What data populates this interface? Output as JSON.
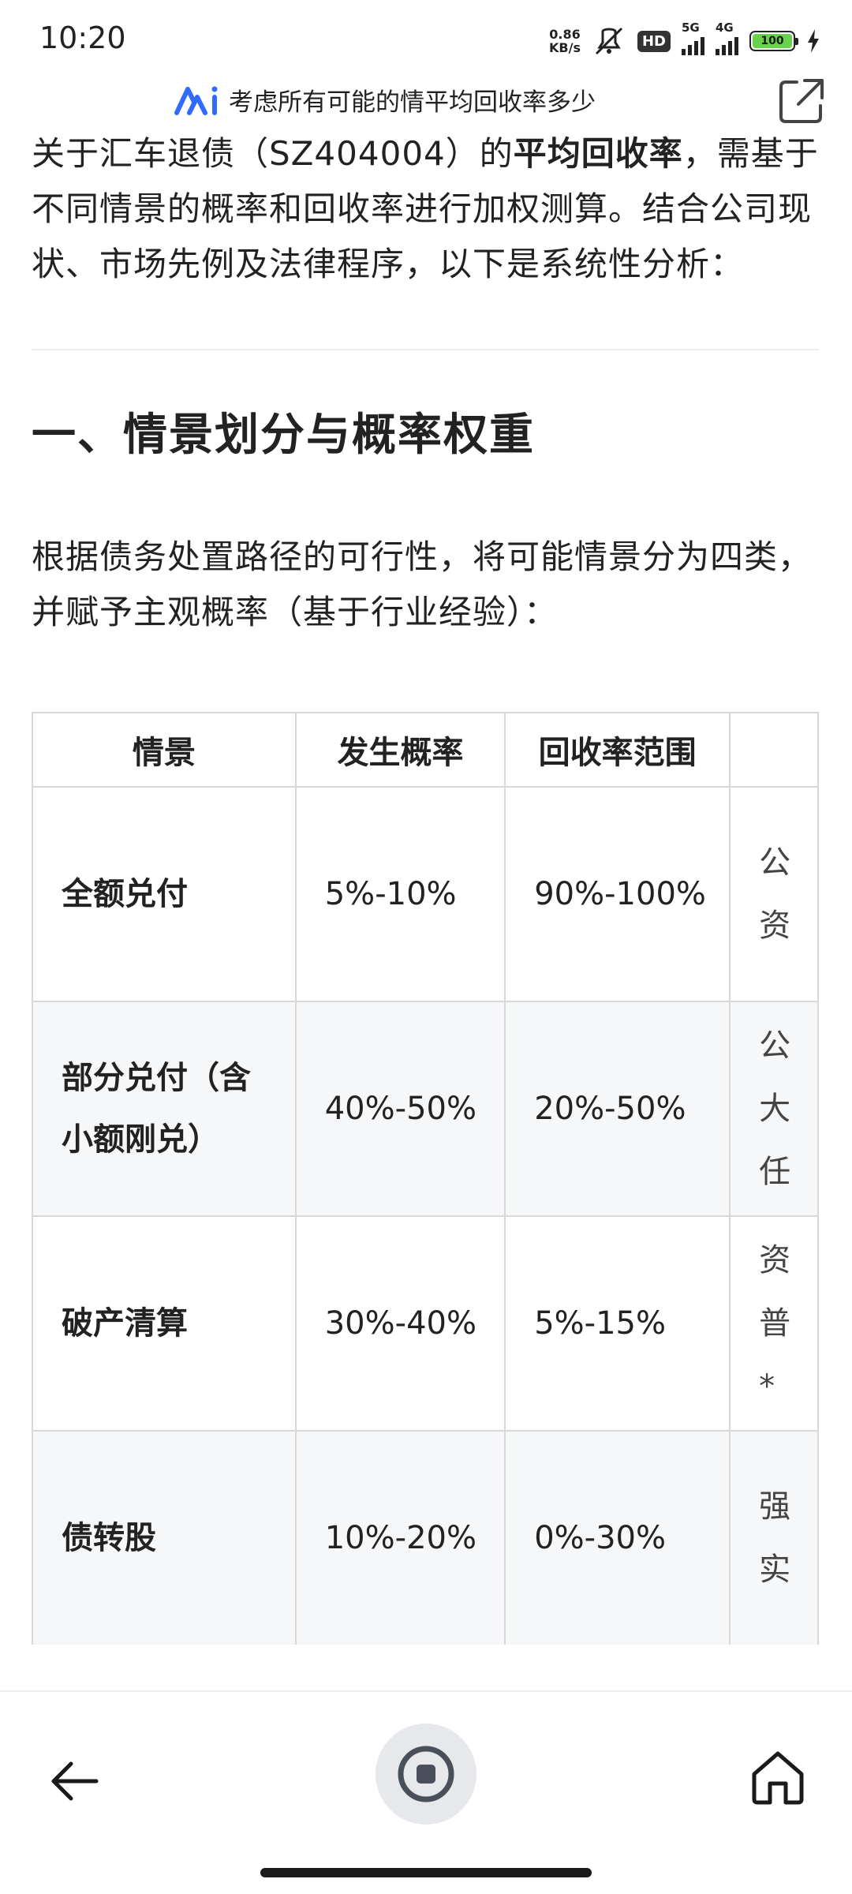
{
  "status_bar": {
    "time": "10:20",
    "net_speed_value": "0.86",
    "net_speed_unit": "KB/s",
    "hd_badge": "HD",
    "signal1_label": "5G",
    "signal2_label": "4G",
    "battery_level": "100",
    "battery_color": "#6ad14e"
  },
  "title_bar": {
    "title": "考虑所有可能的情平均回收率多少",
    "logo_color": "#2f6bff"
  },
  "content": {
    "intro_prefix": "关于汇车退债（SZ404004）的",
    "intro_bold": "平均回收率",
    "intro_suffix": "，需基于不同情景的概率和回收率进行加权测算。结合公司现状、市场先例及法律程序，以下是系统性分析：",
    "section_heading": "一、情景划分与概率权重",
    "section_intro": "根据债务处置路径的可行性，将可能情景分为四类，并赋予主观概率（基于行业经验）：",
    "table": {
      "headers": [
        "情景",
        "发生概率",
        "回收率范围"
      ],
      "rows": [
        {
          "scenario": "全额兑付",
          "probability": "5%-10%",
          "recovery": "90%-100%",
          "col4": [
            "公",
            "资"
          ]
        },
        {
          "scenario": "部分兑付（含小额刚兑）",
          "probability": "40%-50%",
          "recovery": "20%-50%",
          "col4": [
            "公",
            "大",
            "任"
          ]
        },
        {
          "scenario": "破产清算",
          "probability": "30%-40%",
          "recovery": "5%-15%",
          "col4": [
            "资",
            "普",
            "*"
          ]
        },
        {
          "scenario": "债转股",
          "probability": "10%-20%",
          "recovery": "0%-30%",
          "col4": [
            "强",
            "实"
          ]
        }
      ]
    }
  },
  "nav": {
    "back_icon": "arrow-left-icon",
    "center_icon": "stop-icon",
    "home_icon": "home-icon"
  }
}
